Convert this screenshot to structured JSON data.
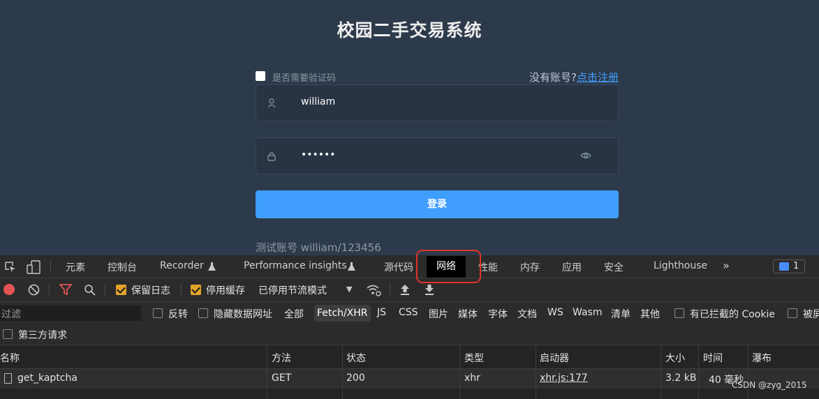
{
  "login": {
    "title": "校园二手交易系统",
    "captcha_label": "是否需要验证码",
    "no_account": "没有账号?",
    "register_link": "点击注册",
    "username_value": "william",
    "password_value": "••••••",
    "login_button": "登录",
    "test_account": "测试账号 william/123456"
  },
  "devtools": {
    "tabs": [
      "元素",
      "控制台",
      "Recorder",
      "Performance insights",
      "源代码",
      "网络",
      "性能",
      "内存",
      "应用",
      "安全",
      "Lighthouse"
    ],
    "active_tab": "网络",
    "more_tabs": "»",
    "message_count": "1",
    "toolbar": {
      "preserve_log": "保留日志",
      "disable_cache": "停用缓存",
      "throttle": "已停用节流模式",
      "throttle_arrow": "▼"
    },
    "filter": {
      "placeholder": "过滤",
      "invert": "反转",
      "hide_data_urls": "隐藏数据网址",
      "types": [
        "全部",
        "Fetch/XHR",
        "JS",
        "CSS",
        "图片",
        "媒体",
        "字体",
        "文档",
        "WS",
        "Wasm",
        "清单",
        "其他"
      ],
      "selected_type": "Fetch/XHR",
      "blocked_cookies": "有已拦截的 Cookie",
      "blocked_requests": "被屏",
      "third_party": "第三方请求"
    },
    "table": {
      "headers": [
        "名称",
        "方法",
        "状态",
        "类型",
        "启动器",
        "大小",
        "时间",
        "瀑布"
      ],
      "rows": [
        {
          "name": "get_kaptcha",
          "method": "GET",
          "status": "200",
          "type": "xhr",
          "initiator": "xhr.js:177",
          "size": "3.2 kB",
          "time": "40 毫秒"
        }
      ]
    }
  },
  "watermark": "CSDN @zyg_2015",
  "colors": {
    "page_bg": "#2d3a4b",
    "accent": "#409eff",
    "devtools_bg": "#242424",
    "highlight": "#e3322c",
    "checkbox_orange": "#e2a32b"
  }
}
